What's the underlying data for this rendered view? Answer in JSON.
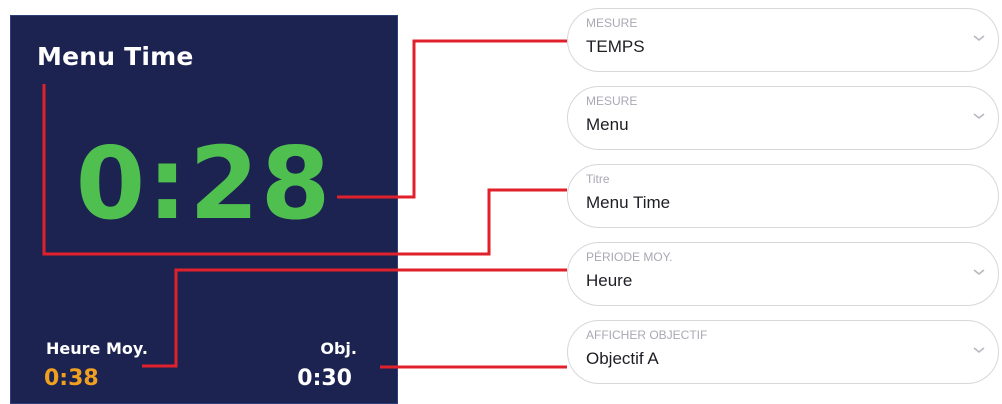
{
  "preview": {
    "title": "Menu Time",
    "value": "0:28",
    "value_color": "#4fc04f",
    "avg_label": "Heure Moy.",
    "avg_value": "0:38",
    "avg_color": "#f0a020",
    "obj_label": "Obj.",
    "obj_value": "0:30",
    "background": "#1c2350"
  },
  "connector_color": "#e0202a",
  "fields": [
    {
      "label": "MESURE",
      "value": "TEMPS",
      "icon": "chevron-down-icon"
    },
    {
      "label": "MESURE",
      "value": "Menu",
      "icon": "chevron-down-icon"
    },
    {
      "label": "Titre",
      "value": "Menu Time"
    },
    {
      "label": "PÉRIODE MOY.",
      "value": "Heure",
      "icon": "chevron-down-icon"
    },
    {
      "label": "AFFICHER OBJECTIF",
      "value": "Objectif A",
      "icon": "chevron-down-icon"
    }
  ]
}
